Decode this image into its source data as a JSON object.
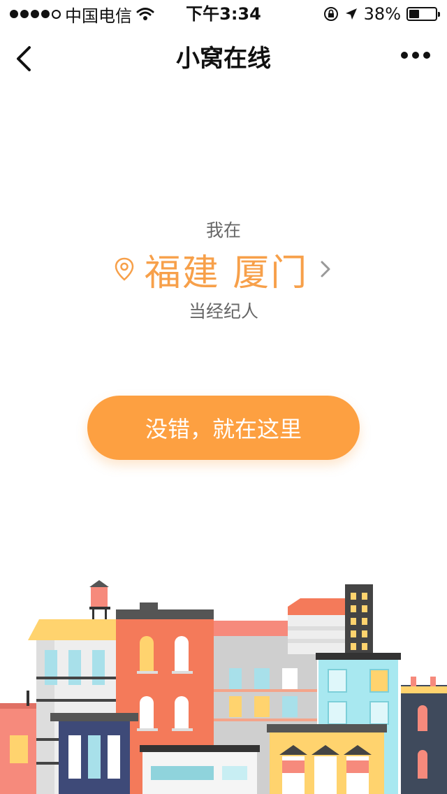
{
  "status_bar": {
    "carrier": "中国电信",
    "time": "下午3:34",
    "battery": "38%",
    "battery_level": 0.38,
    "signal_bars_filled": 4,
    "signal_bars_total": 5
  },
  "nav": {
    "title": "小窝在线"
  },
  "location": {
    "prefix": "我在",
    "city": "福建 厦门",
    "suffix": "当经纪人"
  },
  "confirm_button": {
    "label": "没错，就在这里"
  },
  "colors": {
    "accent": "#fda041",
    "location_text": "#f7a04a",
    "muted_text": "#666666"
  }
}
